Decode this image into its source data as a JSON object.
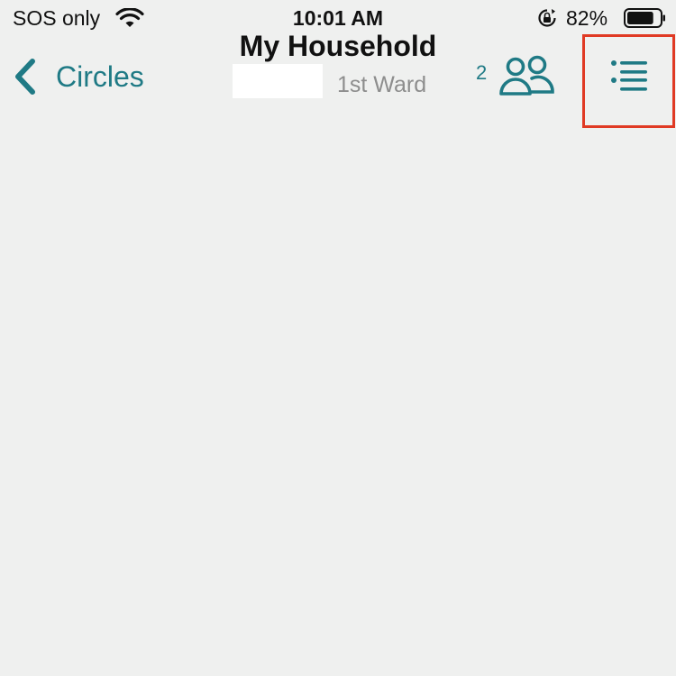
{
  "status_bar": {
    "carrier": "SOS only",
    "time": "10:01 AM",
    "battery_percent": "82%",
    "battery_level": 0.82,
    "icons": [
      "wifi-icon",
      "rotation-lock-icon",
      "battery-icon"
    ]
  },
  "nav": {
    "back_label": "Circles",
    "title": "My Household",
    "subtitle": "1st Ward",
    "member_count": "2",
    "icons": [
      "chevron-left-icon",
      "people-icon",
      "list-icon"
    ]
  },
  "colors": {
    "accent": "#1f7a85",
    "background": "#eff0ef",
    "highlight": "#e03a24",
    "subtitle": "#8d8d8d"
  }
}
